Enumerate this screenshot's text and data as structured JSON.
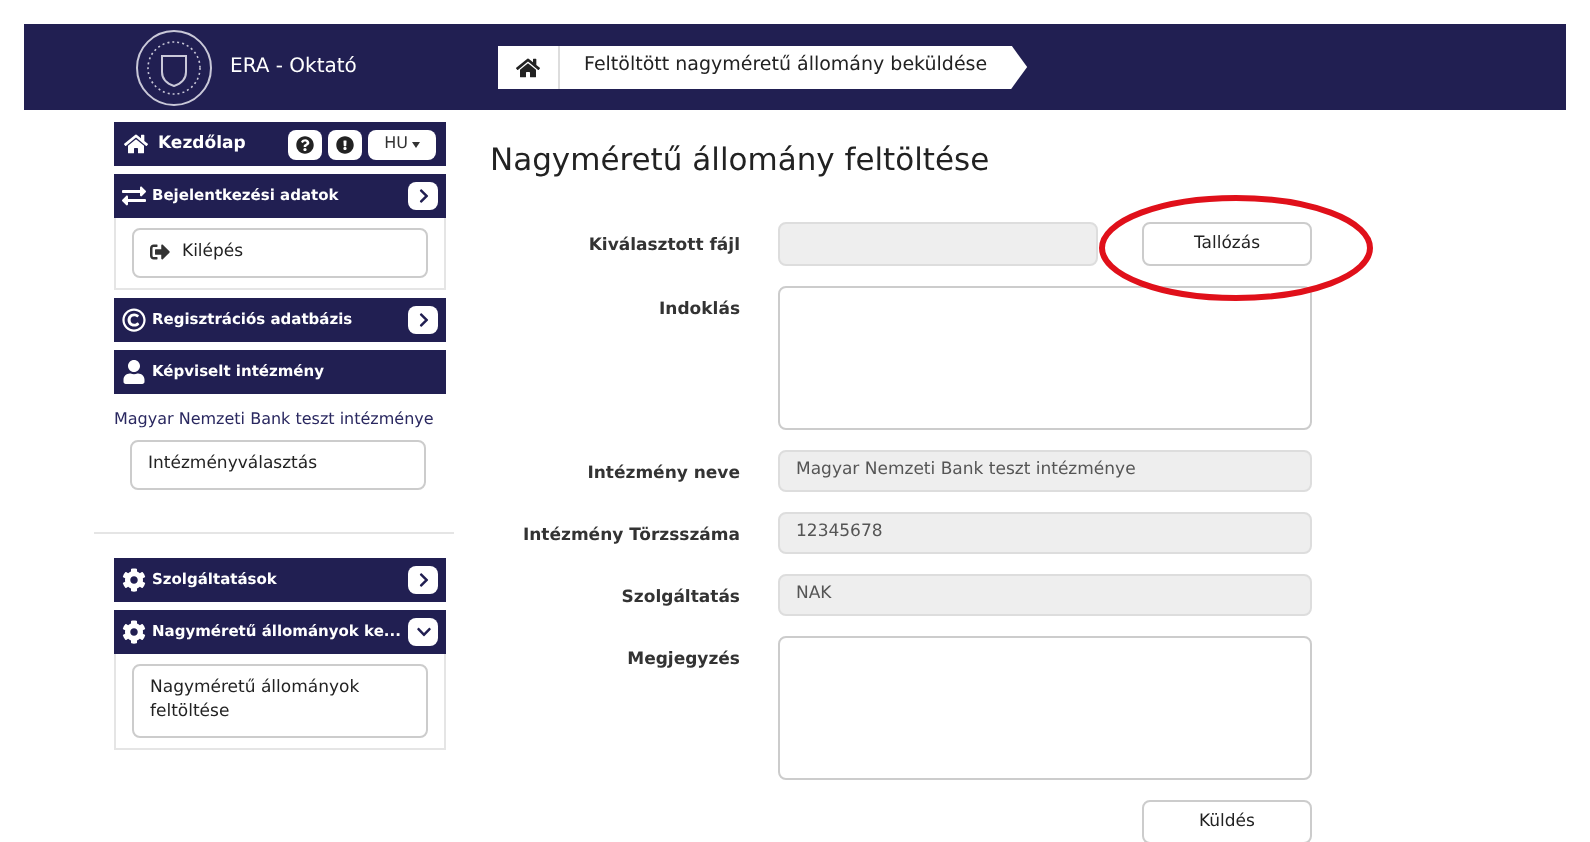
{
  "header": {
    "app_title": "ERA - Oktató",
    "breadcrumb": "Feltöltött nagyméretű állomány beküldése"
  },
  "sidebar": {
    "home": {
      "label": "Kezdőlap",
      "language": "HU"
    },
    "items": [
      {
        "kind": "collapsible",
        "label": "Bejelentkezési adatok",
        "expanded": false,
        "children": [
          {
            "label": "Kilépés"
          }
        ]
      },
      {
        "kind": "collapsible",
        "label": "Regisztrációs adatbázis",
        "expanded": false
      },
      {
        "kind": "static",
        "label": "Képviselt intézmény",
        "note": "Magyar Nemzeti Bank teszt intézménye",
        "children": [
          {
            "label": "Intézményválasztás"
          }
        ]
      },
      {
        "kind": "divider"
      },
      {
        "kind": "collapsible",
        "label": "Szolgáltatások",
        "expanded": false
      },
      {
        "kind": "collapsible",
        "label": "Nagyméretű állományok ke...",
        "expanded": true,
        "children": [
          {
            "label": "Nagyméretű állományok feltöltése"
          }
        ]
      }
    ]
  },
  "main": {
    "title": "Nagyméretű állomány feltöltése",
    "fields": [
      {
        "kind": "file",
        "label": "Kiválasztott fájl",
        "button": "Tallózás"
      },
      {
        "kind": "textarea",
        "label": "Indoklás"
      },
      {
        "kind": "readonly",
        "label": "Intézmény neve",
        "value": "Magyar Nemzeti Bank teszt intézménye"
      },
      {
        "kind": "readonly",
        "label": "Intézmény Törzsszáma",
        "value": "12345678"
      },
      {
        "kind": "readonly",
        "label": "Szolgáltatás",
        "value": "NAK"
      },
      {
        "kind": "textarea",
        "label": "Megjegyzés"
      }
    ],
    "submit": "Küldés"
  }
}
